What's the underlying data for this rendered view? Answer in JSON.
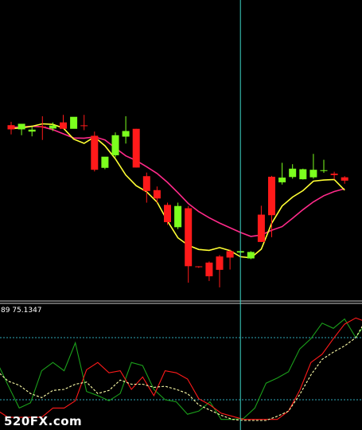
{
  "watermark": "520FX.com",
  "indicator_label": "89 75.1347",
  "colors": {
    "background": "#000000",
    "bull": "#7cff1e",
    "bear": "#ff1a1a",
    "ma_fast": "#ffff33",
    "ma_slow": "#ff2a8a",
    "crosshair": "#3fd6c9",
    "level_line": "#2fa8b8",
    "osc_main": "#1b9f1b",
    "osc_signal": "#ff1a1a",
    "osc_slow": "#ffffaa",
    "separator": "#c8c8c8"
  },
  "chart_data": [
    {
      "type": "candlestick",
      "title": "",
      "ylim": [
        0,
        100
      ],
      "crosshair_bar": 22,
      "candles": [
        {
          "o": 60.8,
          "h": 62.0,
          "l": 57.5,
          "c": 59.3
        },
        {
          "o": 59.3,
          "h": 60.5,
          "l": 57.2,
          "c": 61.3
        },
        {
          "o": 58.5,
          "h": 60.2,
          "l": 56.8,
          "c": 59.2
        },
        {
          "o": 60.2,
          "h": 64.0,
          "l": 55.5,
          "c": 59.8
        },
        {
          "o": 59.6,
          "h": 61.8,
          "l": 58.7,
          "c": 60.7
        },
        {
          "o": 61.8,
          "h": 64.5,
          "l": 60.2,
          "c": 59.5
        },
        {
          "o": 59.5,
          "h": 62.8,
          "l": 60.5,
          "c": 63.8
        },
        {
          "o": 60.6,
          "h": 64.5,
          "l": 59.0,
          "c": 60.2
        },
        {
          "o": 57.0,
          "h": 58.5,
          "l": 44.2,
          "c": 44.8
        },
        {
          "o": 45.5,
          "h": 49.2,
          "l": 45.0,
          "c": 49.5
        },
        {
          "o": 50.0,
          "h": 58.2,
          "l": 49.3,
          "c": 57.2
        },
        {
          "o": 56.7,
          "h": 64.0,
          "l": 54.2,
          "c": 58.7
        },
        {
          "o": 59.5,
          "h": 59.5,
          "l": 45.6,
          "c": 45.6
        },
        {
          "o": 42.5,
          "h": 43.8,
          "l": 33.0,
          "c": 37.2
        },
        {
          "o": 37.5,
          "h": 38.8,
          "l": 33.0,
          "c": 34.5
        },
        {
          "o": 32.2,
          "h": 33.0,
          "l": 25.0,
          "c": 26.0
        },
        {
          "o": 24.2,
          "h": 33.0,
          "l": 23.5,
          "c": 31.8
        },
        {
          "o": 31.0,
          "h": 31.8,
          "l": 4.3,
          "c": 10.2
        },
        {
          "o": 10.0,
          "h": 10.2,
          "l": 9.6,
          "c": 9.9
        },
        {
          "o": 11.5,
          "h": 11.9,
          "l": 4.9,
          "c": 6.6
        },
        {
          "o": 13.7,
          "h": 14.2,
          "l": 2.6,
          "c": 8.9
        },
        {
          "o": 15.6,
          "h": 16.2,
          "l": 9.0,
          "c": 13.3
        },
        {
          "o": 15.1,
          "h": 15.7,
          "l": 13.3,
          "c": 15.6
        },
        {
          "o": 13.0,
          "h": 15.6,
          "l": 12.7,
          "c": 15.3
        },
        {
          "o": 28.7,
          "h": 31.9,
          "l": 18.9,
          "c": 18.9
        },
        {
          "o": 42.3,
          "h": 42.6,
          "l": 20.6,
          "c": 28.5
        },
        {
          "o": 40.3,
          "h": 47.3,
          "l": 39.5,
          "c": 42.0
        },
        {
          "o": 42.2,
          "h": 46.8,
          "l": 41.6,
          "c": 45.2
        },
        {
          "o": 41.4,
          "h": 45.2,
          "l": 41.3,
          "c": 45.0
        },
        {
          "o": 42.1,
          "h": 50.5,
          "l": 41.6,
          "c": 44.8
        },
        {
          "o": 44.4,
          "h": 48.4,
          "l": 43.7,
          "c": 44.5
        },
        {
          "o": 43.4,
          "h": 44.1,
          "l": 41.3,
          "c": 42.9
        },
        {
          "o": 42.1,
          "h": 42.5,
          "l": 39.8,
          "c": 40.9
        }
      ],
      "ma_fast": [
        59.6,
        59.8,
        60.4,
        61.3,
        61.1,
        59.8,
        55.8,
        54.3,
        56.6,
        53.4,
        48.7,
        42.9,
        39.1,
        36.9,
        33.2,
        26.4,
        20.4,
        17.7,
        16.2,
        15.9,
        16.9,
        15.8,
        13.6,
        13.2,
        16.3,
        25.6,
        31.8,
        35.0,
        37.3,
        40.7,
        41.1,
        41.3,
        37.5
      ],
      "ma_slow": [
        60.0,
        60.2,
        60.4,
        60.2,
        59.2,
        57.7,
        56.2,
        56.1,
        56.6,
        55.5,
        52.6,
        49.8,
        48.1,
        45.9,
        43.5,
        40.3,
        36.6,
        32.7,
        29.8,
        27.6,
        25.7,
        24.0,
        22.3,
        20.9,
        21.4,
        23.1,
        24.4,
        27.4,
        30.5,
        33.3,
        35.5,
        37.0,
        38.0
      ]
    },
    {
      "type": "line",
      "title": "",
      "ylim": [
        0,
        100
      ],
      "levels": [
        80,
        20
      ],
      "series": [
        {
          "key": "main",
          "values": [
            57,
            34,
            12,
            17,
            48,
            56,
            48,
            75,
            28,
            24,
            19,
            26,
            56,
            53,
            30,
            20,
            18,
            6,
            9,
            18,
            1,
            1,
            2,
            12,
            36,
            41,
            47,
            69,
            79,
            94,
            89,
            98,
            80,
            96
          ]
        },
        {
          "key": "signal",
          "values": [
            10,
            3,
            3,
            3,
            3,
            12,
            12,
            19,
            49,
            56,
            46,
            48,
            30,
            42,
            24,
            48,
            46,
            40,
            21,
            15,
            7,
            4,
            1,
            1,
            1,
            1,
            9,
            29,
            56,
            64,
            79,
            93,
            99,
            95
          ]
        },
        {
          "key": "slow",
          "values": [
            48,
            38,
            34,
            26,
            22,
            29,
            30,
            35,
            37,
            26,
            29,
            39,
            35,
            35,
            32,
            33,
            30,
            26,
            15,
            10,
            5,
            1,
            0,
            0,
            0,
            4,
            9,
            25,
            44,
            59,
            66,
            72,
            80,
            99
          ]
        }
      ]
    }
  ]
}
